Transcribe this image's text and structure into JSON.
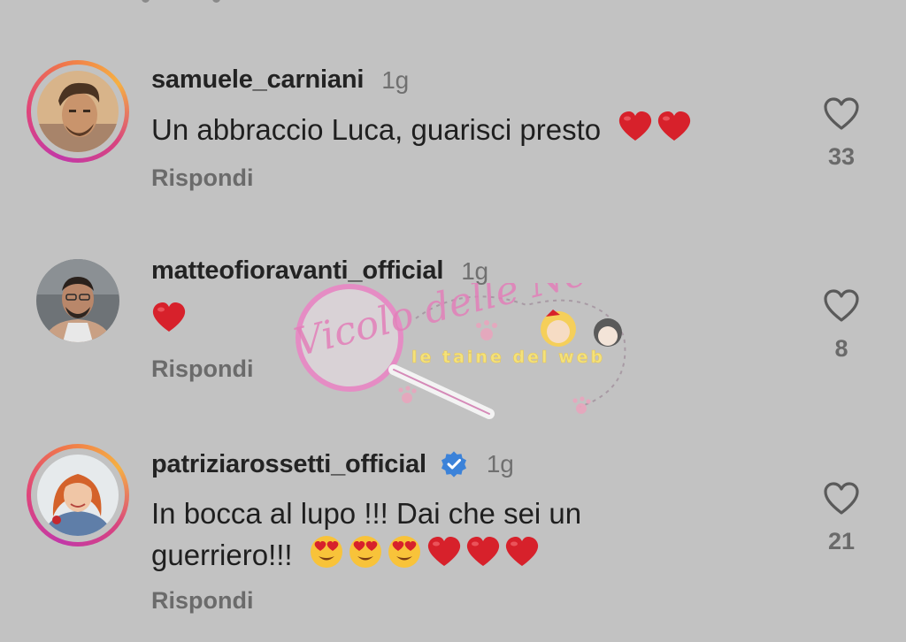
{
  "comments": [
    {
      "username": "samuele_carniani",
      "time": "1g",
      "text": "Un abbraccio Luca, guarisci presto",
      "emoji": [
        "red-heart",
        "red-heart"
      ],
      "reply_label": "Rispondi",
      "likes": "33",
      "verified": false
    },
    {
      "username": "matteofioravanti_official",
      "time": "1g",
      "text": "",
      "emoji": [
        "red-heart"
      ],
      "reply_label": "Rispondi",
      "likes": "8",
      "verified": false
    },
    {
      "username": "patriziarossetti_official",
      "time": "1g",
      "text_line1": "In bocca al lupo !!! Dai che sei un",
      "text_line2": "guerriero!!!",
      "emoji": [
        "heart-eyes",
        "heart-eyes",
        "heart-eyes",
        "red-heart",
        "red-heart",
        "red-heart"
      ],
      "reply_label": "Rispondi",
      "likes": "21",
      "verified": true
    }
  ],
  "watermark": {
    "logo_text": "Vicolo delle News",
    "tagline": "le taine del web"
  },
  "colors": {
    "background": "#c2c2c2",
    "heart": "#d7212b",
    "verified": "#3b82d9"
  }
}
